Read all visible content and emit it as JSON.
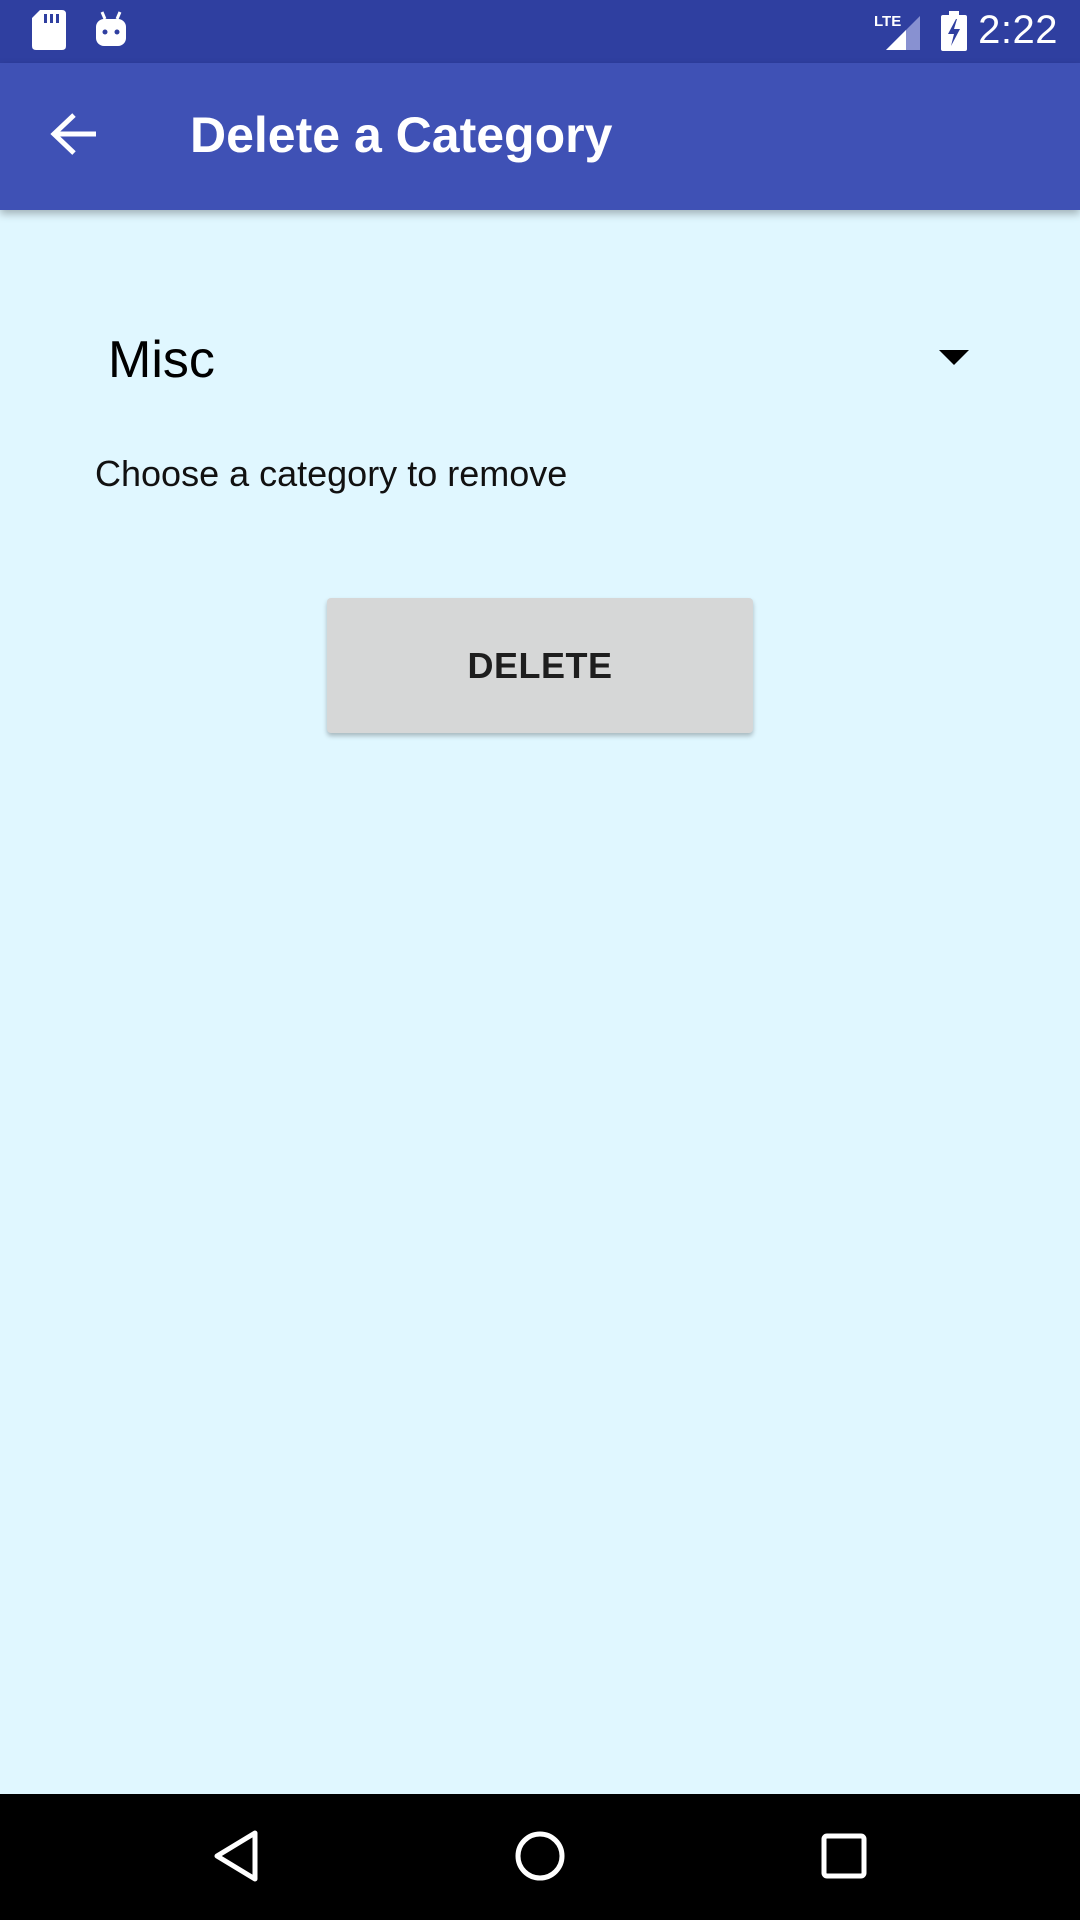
{
  "status_bar": {
    "time": "2:22",
    "network": "LTE",
    "icons": [
      "sd-card-icon",
      "android-icon",
      "lte-signal-icon",
      "battery-charging-icon"
    ]
  },
  "app_bar": {
    "title": "Delete a Category",
    "back_icon": "arrow-back-icon"
  },
  "form": {
    "category_selected": "Misc",
    "helper_text": "Choose a category to remove",
    "delete_label": "DELETE"
  },
  "nav_bar": {
    "icons": [
      "back-triangle-icon",
      "home-circle-icon",
      "recents-square-icon"
    ]
  },
  "colors": {
    "status_bar": "#2f3fa0",
    "app_bar": "#3f51b5",
    "background": "#e0f7ff",
    "button": "#d6d7d7"
  }
}
